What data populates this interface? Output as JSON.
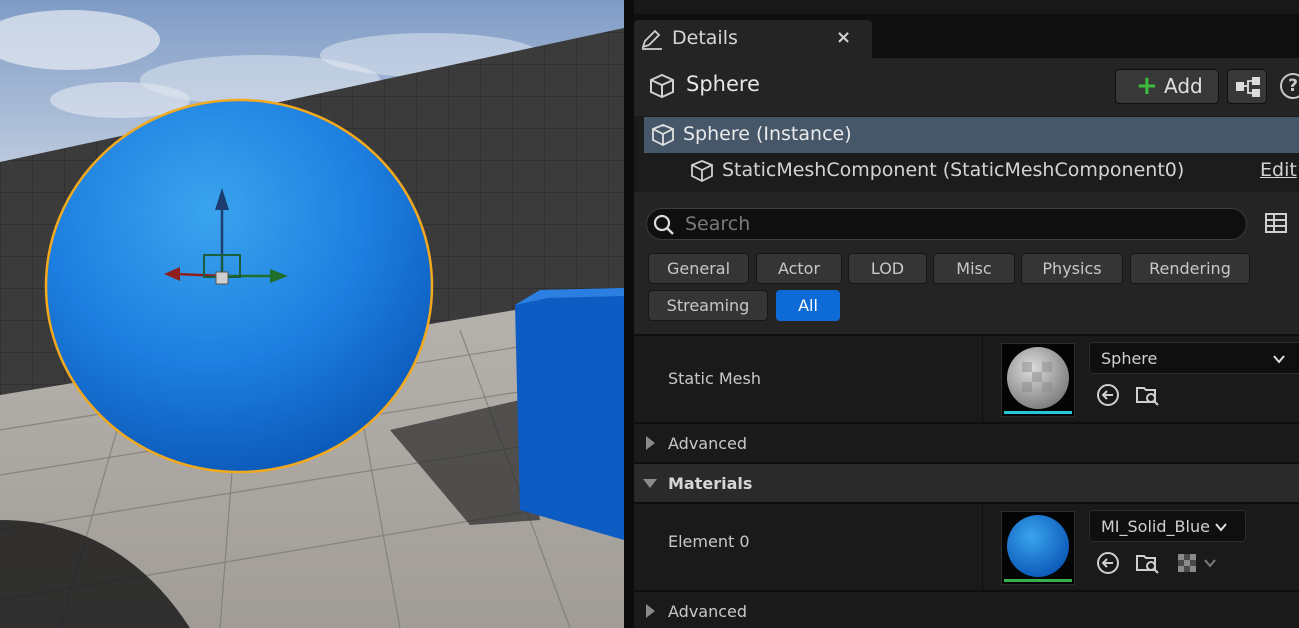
{
  "details_tab": {
    "title": "Details",
    "close_glyph": "×"
  },
  "actor": {
    "name": "Sphere",
    "icon": "actor-cube-icon"
  },
  "toolbar": {
    "add_plus": "+",
    "add_label": "Add",
    "blueprint_icon": "blueprint-hierarchy-icon",
    "help_glyph": "?"
  },
  "components": [
    {
      "label": "Sphere (Instance)",
      "selected": true
    },
    {
      "label": "StaticMeshComponent (StaticMeshComponent0)",
      "action": "Edit"
    }
  ],
  "search": {
    "placeholder": "Search",
    "value": ""
  },
  "filters": [
    "General",
    "Actor",
    "LOD",
    "Misc",
    "Physics",
    "Rendering",
    "Streaming",
    "All"
  ],
  "active_filter": "All",
  "properties": {
    "static_mesh": {
      "label": "Static Mesh",
      "value": "Sphere"
    },
    "advanced_1": "Advanced",
    "materials_section": "Materials",
    "element0": {
      "label": "Element 0",
      "value": "MI_Solid_Blue"
    },
    "advanced_2": "Advanced"
  },
  "colors": {
    "accent": "#0d6ad6",
    "selection": "#46576a",
    "sphere": "#1d7fe0",
    "outline": "#f2a91e",
    "add_green": "#3dbb3d",
    "mesh_bar": "#24c6d8",
    "material_bar": "#35b04a"
  }
}
